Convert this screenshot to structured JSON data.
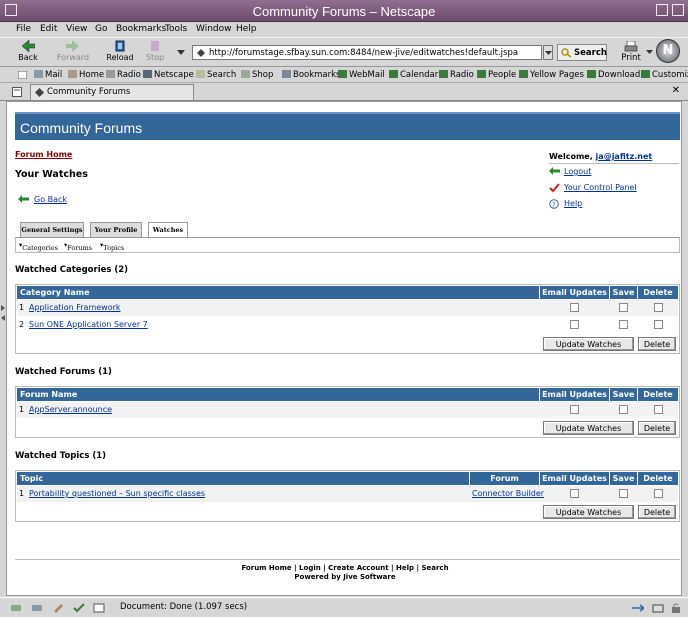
{
  "window": {
    "title": "Community Forums – Netscape"
  },
  "menu": [
    "File",
    "Edit",
    "View",
    "Go",
    "Bookmarks",
    "Tools",
    "Window",
    "Help"
  ],
  "nav": {
    "back": "Back",
    "forward": "Forward",
    "reload": "Reload",
    "stop": "Stop",
    "url": "http://forumstage.sfbay.sun.com:8484/new-jive/editwatches!default.jspa",
    "search": "Search",
    "print": "Print"
  },
  "personal_toolbar": [
    "Mail",
    "Home",
    "Radio",
    "Netscape",
    "Search",
    "Shop",
    "Bookmarks",
    "WebMail",
    "Calendar",
    "Radio",
    "People",
    "Yellow Pages",
    "Download",
    "Customize"
  ],
  "browser_tab": {
    "label": "Community Forums"
  },
  "page": {
    "header": "Community Forums",
    "forum_home": "Forum Home",
    "heading": "Your Watches",
    "go_back": "Go Back",
    "welcome_prefix": "Welcome,",
    "user": "ja@jafitz.net",
    "logout": "Logout",
    "control_panel": "Your Control Panel",
    "help": "Help",
    "tabs": [
      "General Settings",
      "Your Profile",
      "Watches"
    ],
    "subtabs": [
      "Categories",
      "Forums",
      "Topics"
    ],
    "col_email": "Email Updates",
    "col_save": "Save",
    "col_delete": "Delete",
    "update_btn": "Update Watches",
    "delete_btn": "Delete",
    "categories": {
      "title": "Watched Categories (2)",
      "col": "Category Name",
      "rows": [
        {
          "n": "1",
          "name": "Application Framework"
        },
        {
          "n": "2",
          "name": "Sun ONE Application Server 7"
        }
      ]
    },
    "forums": {
      "title": "Watched Forums (1)",
      "col": "Forum Name",
      "rows": [
        {
          "n": "1",
          "name": "AppServer.announce"
        }
      ]
    },
    "topics": {
      "title": "Watched Topics (1)",
      "col": "Topic",
      "col_forum": "Forum",
      "rows": [
        {
          "n": "1",
          "name": "Portability questioned – Sun specific classes",
          "forum": "Connector Builder"
        }
      ]
    },
    "footer_links": "Forum Home | Login | Create Account | Help | Search",
    "powered": "Powered by Jive Software"
  },
  "status": {
    "text": "Document: Done (1.097 secs)"
  },
  "colors": {
    "header": "#336699",
    "link": "#003399",
    "titlebar": "#7a567a"
  }
}
